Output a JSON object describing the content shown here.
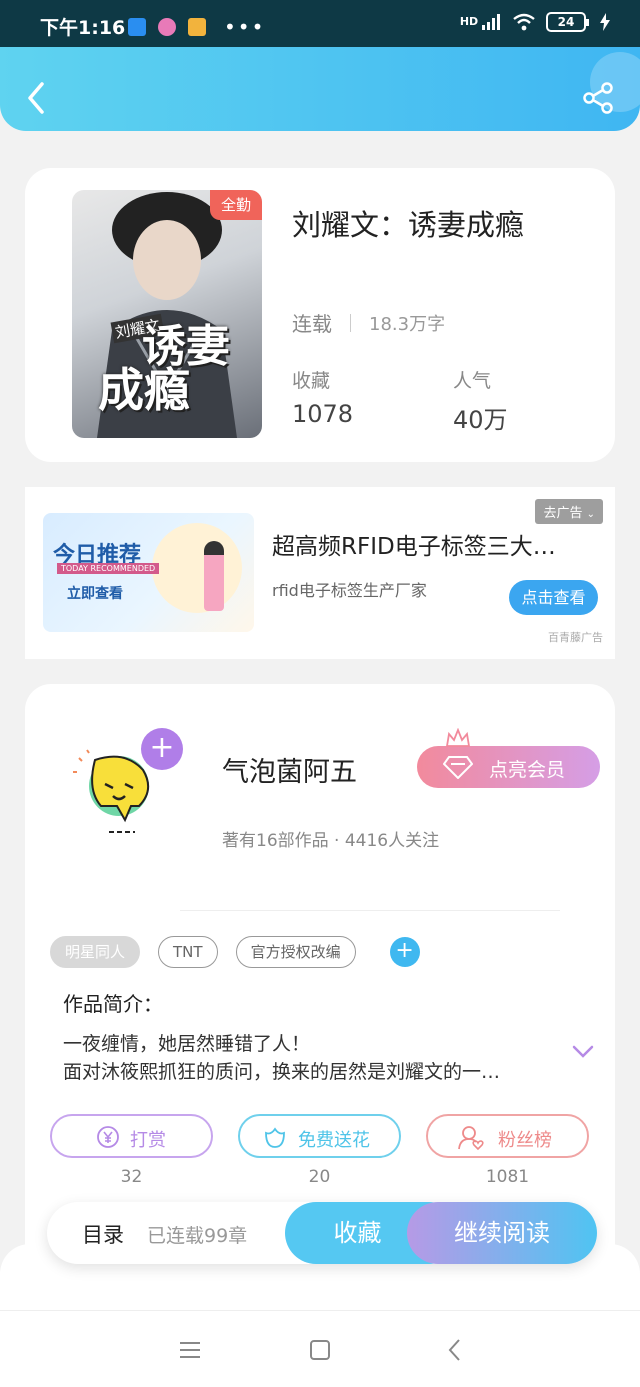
{
  "status_bar": {
    "time": "下午1:16",
    "network": "HD",
    "battery": "24"
  },
  "header": {
    "back_icon": "chevron-left-icon",
    "share_icon": "share-icon"
  },
  "book": {
    "cover_badge": "全勤",
    "cover_title_line1": "诱妻",
    "cover_title_line2": "成瘾",
    "cover_small": "刘耀文",
    "title": "刘耀文：诱妻成瘾",
    "status": "连载",
    "word_count": "18.3万字",
    "stats": [
      {
        "label": "收藏",
        "value": "1078"
      },
      {
        "label": "人气",
        "value": "40万"
      }
    ]
  },
  "ad": {
    "image_title": "今日推荐",
    "image_en": "TODAY RECOMMENDED",
    "image_cta": "立即查看",
    "remove_label": "去广告",
    "title": "超高频RFID电子标签三大…",
    "subtitle": "rfid电子标签生产厂家",
    "button_label": "点击查看",
    "source": "百青藤广告"
  },
  "author": {
    "name": "气泡菌阿五",
    "meta": "著有16部作品 · 4416人关注",
    "vip_label": "点亮会员"
  },
  "tags": [
    "明星同人",
    "TNT",
    "官方授权改编"
  ],
  "intro": {
    "heading": "作品简介：",
    "line1": "一夜缠情，她居然睡错了人！",
    "line2": "面对沐筱熙抓狂的质问，换来的居然是刘耀文的一…"
  },
  "actions": [
    {
      "label": "打赏",
      "count": "32",
      "icon": "yen-icon",
      "color": "#b58ae6"
    },
    {
      "label": "免费送花",
      "count": "20",
      "icon": "flower-icon",
      "color": "#4fc4e8"
    },
    {
      "label": "粉丝榜",
      "count": "1081",
      "icon": "fans-icon",
      "color": "#ee8a8a"
    }
  ],
  "bottom_bar": {
    "catalog": "目录",
    "chapters": "已连载99章",
    "collect": "收藏",
    "read": "继续阅读"
  }
}
